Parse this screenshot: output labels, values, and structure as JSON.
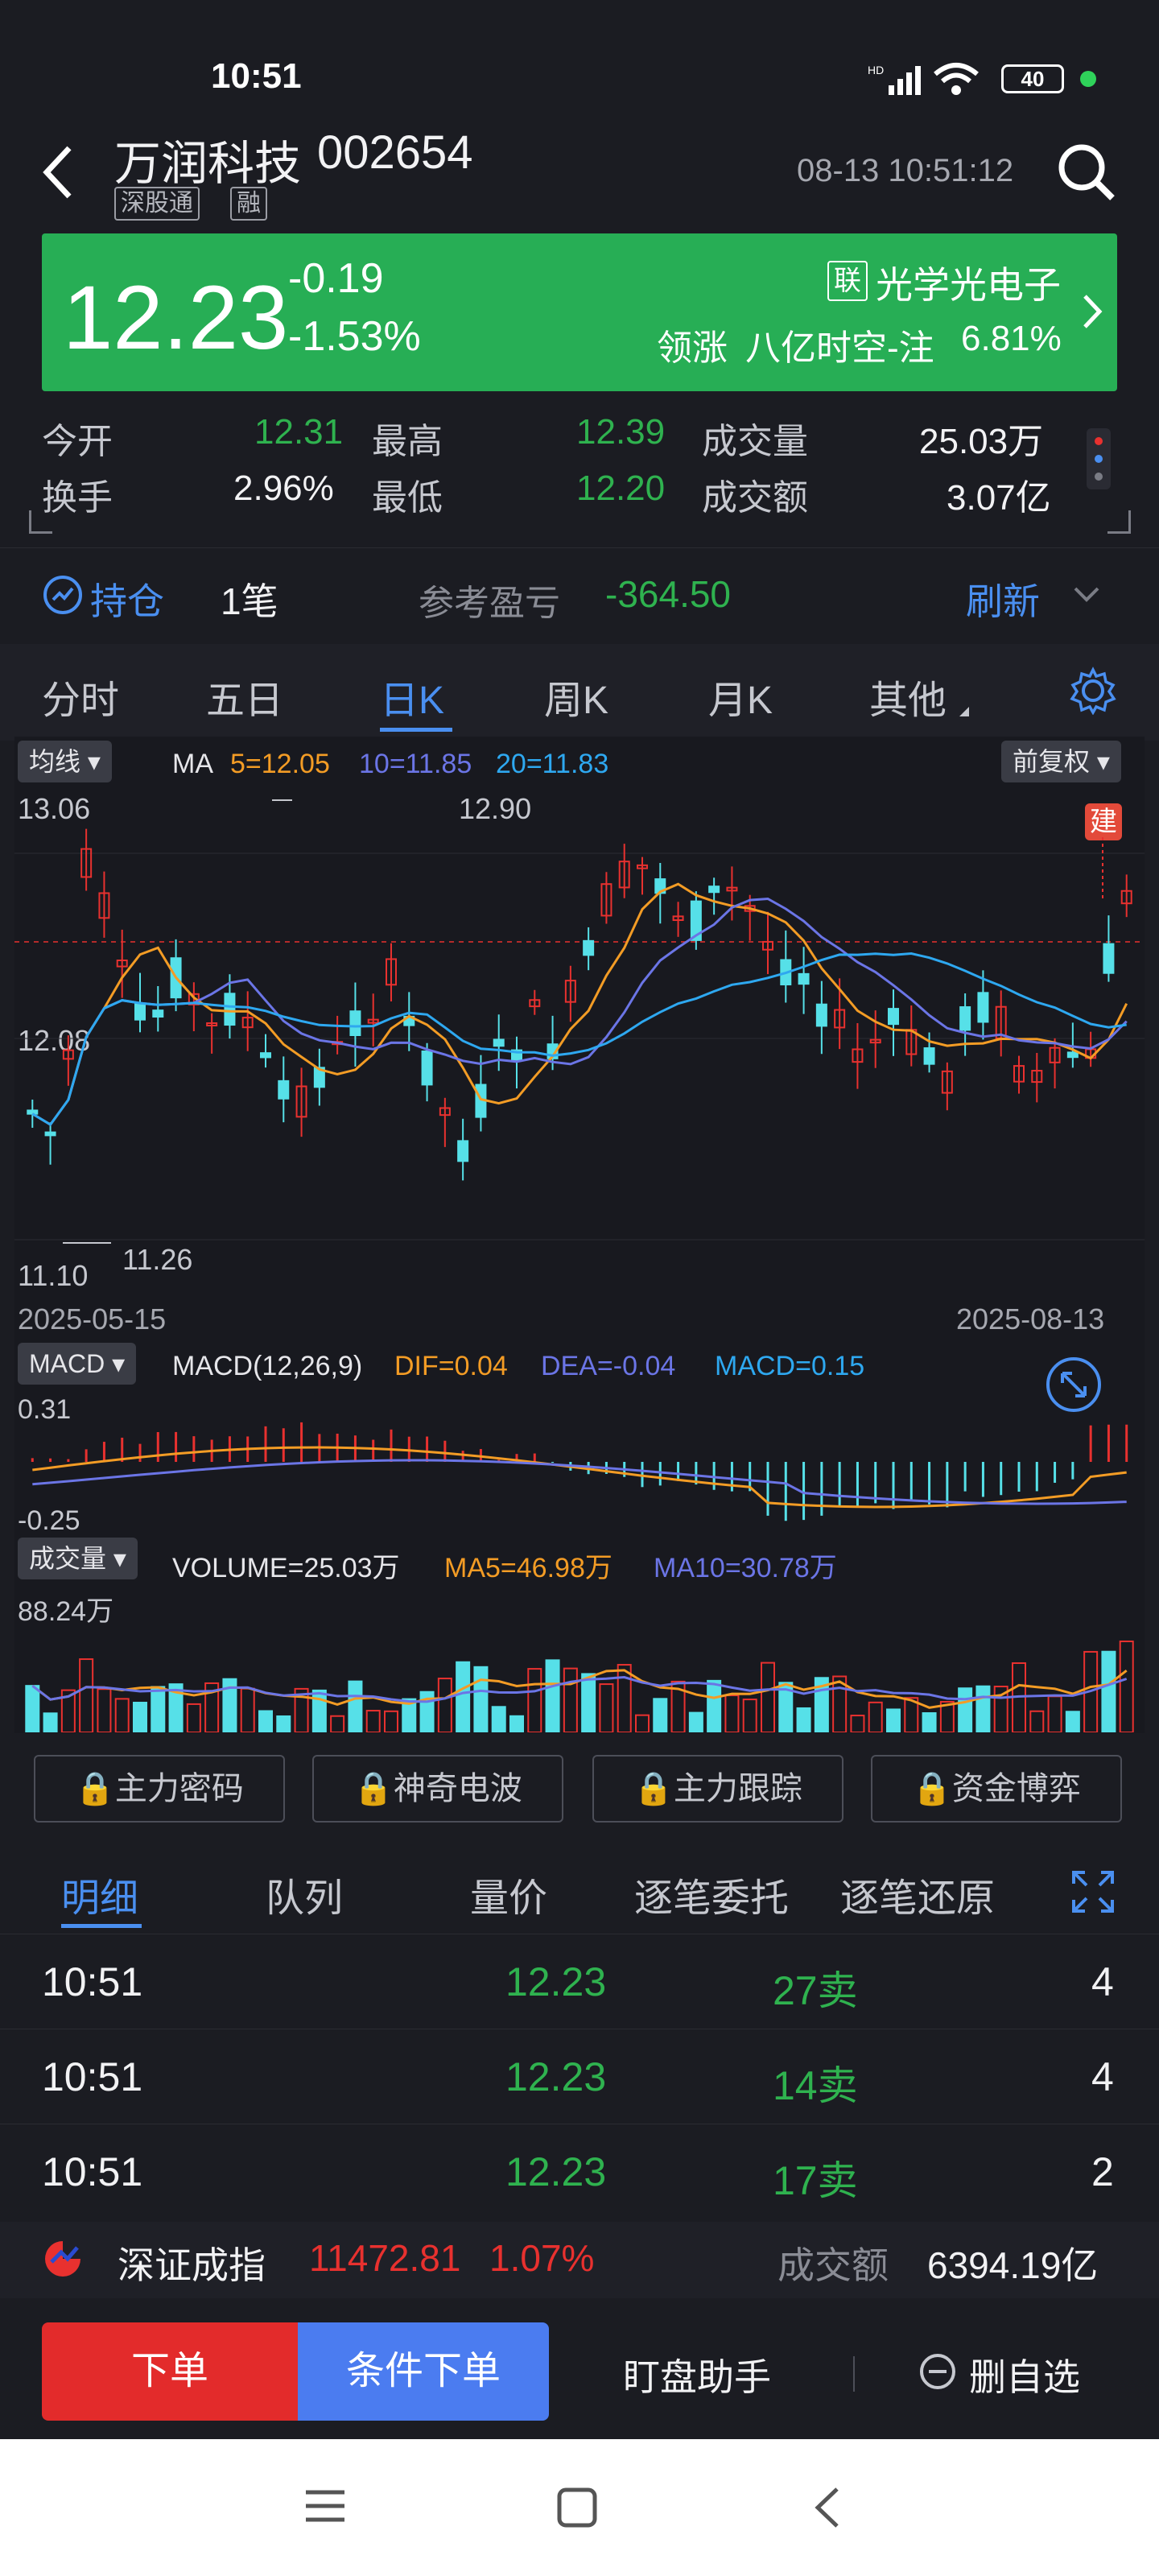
{
  "status": {
    "time": "10:51",
    "battery": "40"
  },
  "header": {
    "stock_name": "万润科技",
    "stock_code": "002654",
    "badges": [
      "深股通",
      "融"
    ],
    "datetime": "08-13 10:51:12"
  },
  "quote": {
    "price": "12.23",
    "change": "-0.19",
    "change_pct": "-1.53%",
    "concept_badge": "联",
    "concept": "光学光电子",
    "leader_label": "领涨",
    "leader": "八亿时空-注",
    "leader_pct": "6.81%"
  },
  "stats": {
    "open_label": "今开",
    "open": "12.31",
    "high_label": "最高",
    "high": "12.39",
    "vol_label": "成交量",
    "vol": "25.03万",
    "turnover_label": "换手",
    "turnover": "2.96%",
    "low_label": "最低",
    "low": "12.20",
    "amount_label": "成交额",
    "amount": "3.07亿"
  },
  "position": {
    "label": "持仓",
    "count": "1笔",
    "pnl_label": "参考盈亏",
    "pnl": "-364.50",
    "refresh": "刷新"
  },
  "chart_tabs": [
    "分时",
    "五日",
    "日K",
    "周K",
    "月K",
    "其他"
  ],
  "active_tab": 2,
  "kline": {
    "ma_dropdown": "均线",
    "ma_label": "MA",
    "ma5": "5=12.05",
    "ma10": "10=11.85",
    "ma20": "20=11.83",
    "adjust": "前复权",
    "price_top": "13.06",
    "price_mid": "12.08",
    "price_bottom": "11.10",
    "max_mark": "12.90",
    "min_mark": "11.26",
    "build_tag": "建",
    "date_start": "2025-05-15",
    "date_end": "2025-08-13",
    "colors": {
      "up": "#e8312f",
      "down": "#56e0e8",
      "ma5": "#f39c25",
      "ma10": "#6b75e6",
      "ma20": "#2ea8f0"
    }
  },
  "macd": {
    "dropdown": "MACD",
    "label": "MACD(12,26,9)",
    "dif": "DIF=0.04",
    "dea": "DEA=-0.04",
    "macd": "MACD=0.15",
    "top": "0.31",
    "bottom": "-0.25"
  },
  "volume": {
    "dropdown": "成交量",
    "label": "VOLUME=25.03万",
    "ma5": "MA5=46.98万",
    "ma10": "MA10=30.78万",
    "top": "88.24万"
  },
  "tools": [
    "主力密码",
    "神奇电波",
    "主力跟踪",
    "资金博弈"
  ],
  "detail_tabs": [
    "明细",
    "队列",
    "量价",
    "逐笔委托",
    "逐笔还原"
  ],
  "trades": [
    {
      "time": "10:51",
      "price": "12.23",
      "vol": "27卖",
      "count": "4"
    },
    {
      "time": "10:51",
      "price": "12.23",
      "vol": "14卖",
      "count": "4"
    },
    {
      "time": "10:51",
      "price": "12.23",
      "vol": "17卖",
      "count": "2"
    }
  ],
  "ticker": {
    "index_name": "深证成指",
    "index_value": "11472.81",
    "index_pct": "1.07%",
    "amount_label": "成交额",
    "amount": "6394.19亿"
  },
  "actions": {
    "order": "下单",
    "cond_order": "条件下单",
    "monitor": "盯盘助手",
    "remove": "删自选"
  }
}
